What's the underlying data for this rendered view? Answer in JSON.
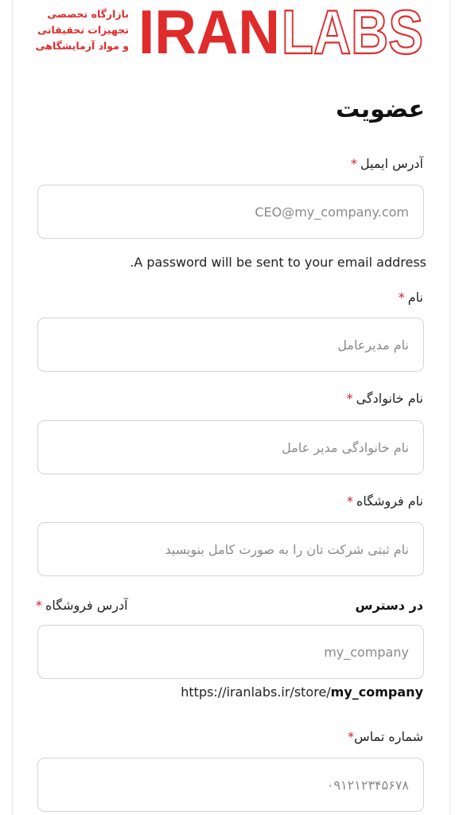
{
  "brand": {
    "tagline_lines": [
      "بازارگاه تخصصی",
      "تجهیزات تحقیقاتی",
      "و مواد آزمایشگاهی"
    ],
    "name_solid": "IRAN",
    "name_outline": "LABS",
    "color": "#e02b2b"
  },
  "page": {
    "title": "عضویت"
  },
  "required_mark": "*",
  "email": {
    "label": "آدرس ایمیل",
    "placeholder": "CEO@my_company.com",
    "value": "",
    "hint": "A password will be sent to your email address."
  },
  "first_name": {
    "label": "نام",
    "placeholder": "نام مدیرعامل",
    "value": ""
  },
  "last_name": {
    "label": "نام خانوادگی",
    "placeholder": "نام خانوادگی مدیر عامل",
    "value": ""
  },
  "store_name": {
    "label": "نام فروشگاه",
    "placeholder": "نام ثبتی شرکت تان را به صورت کامل بنویسید",
    "value": ""
  },
  "store_address": {
    "label": "آدرس فروشگاه",
    "availability": "در دسترس",
    "placeholder": "my_company",
    "value": "",
    "url_prefix": "https://iranlabs.ir/store/",
    "url_slug": "my_company"
  },
  "phone": {
    "label": "شماره تماس",
    "placeholder": "۰۹۱۲۱۲۳۴۵۶۷۸",
    "value": ""
  },
  "colors": {
    "required": "#d0202a",
    "border": "#d4d4d4"
  }
}
